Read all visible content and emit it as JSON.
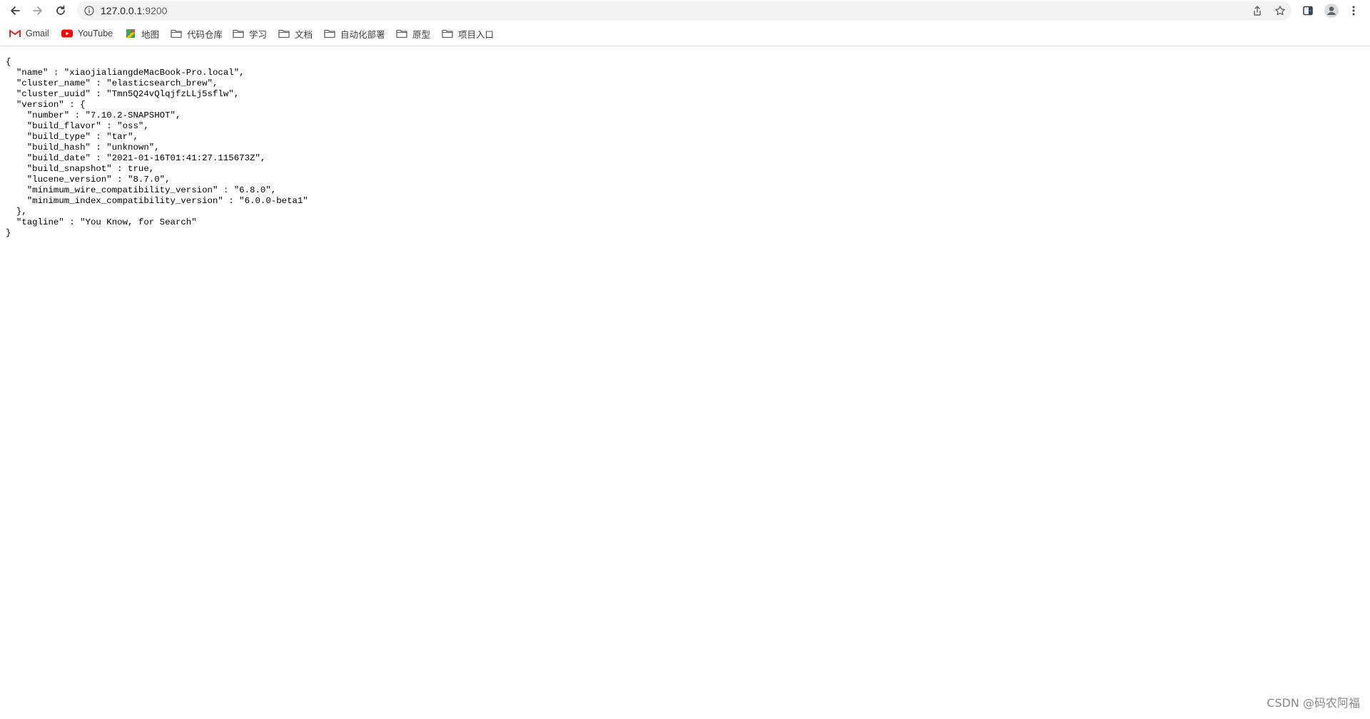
{
  "browser": {
    "url_host": "127.0.0.1",
    "url_port": ":9200"
  },
  "bookmarks": [
    {
      "label": "Gmail",
      "icon": "gmail-icon"
    },
    {
      "label": "YouTube",
      "icon": "youtube-icon"
    },
    {
      "label": "地图",
      "icon": "maps-icon"
    },
    {
      "label": "代码仓库",
      "icon": "folder-icon"
    },
    {
      "label": "学习",
      "icon": "folder-icon"
    },
    {
      "label": "文档",
      "icon": "folder-icon"
    },
    {
      "label": "自动化部署",
      "icon": "folder-icon"
    },
    {
      "label": "原型",
      "icon": "folder-icon"
    },
    {
      "label": "项目入口",
      "icon": "folder-icon"
    }
  ],
  "json_response": {
    "name": "xiaojialiangdeMacBook-Pro.local",
    "cluster_name": "elasticsearch_brew",
    "cluster_uuid": "Tmn5Q24vQlqjfzLLj5sflw",
    "version": {
      "number": "7.10.2-SNAPSHOT",
      "build_flavor": "oss",
      "build_type": "tar",
      "build_hash": "unknown",
      "build_date": "2021-01-16T01:41:27.115673Z",
      "build_snapshot": true,
      "lucene_version": "8.7.0",
      "minimum_wire_compatibility_version": "6.8.0",
      "minimum_index_compatibility_version": "6.0.0-beta1"
    },
    "tagline": "You Know, for Search"
  },
  "watermark": "CSDN @码农阿福"
}
